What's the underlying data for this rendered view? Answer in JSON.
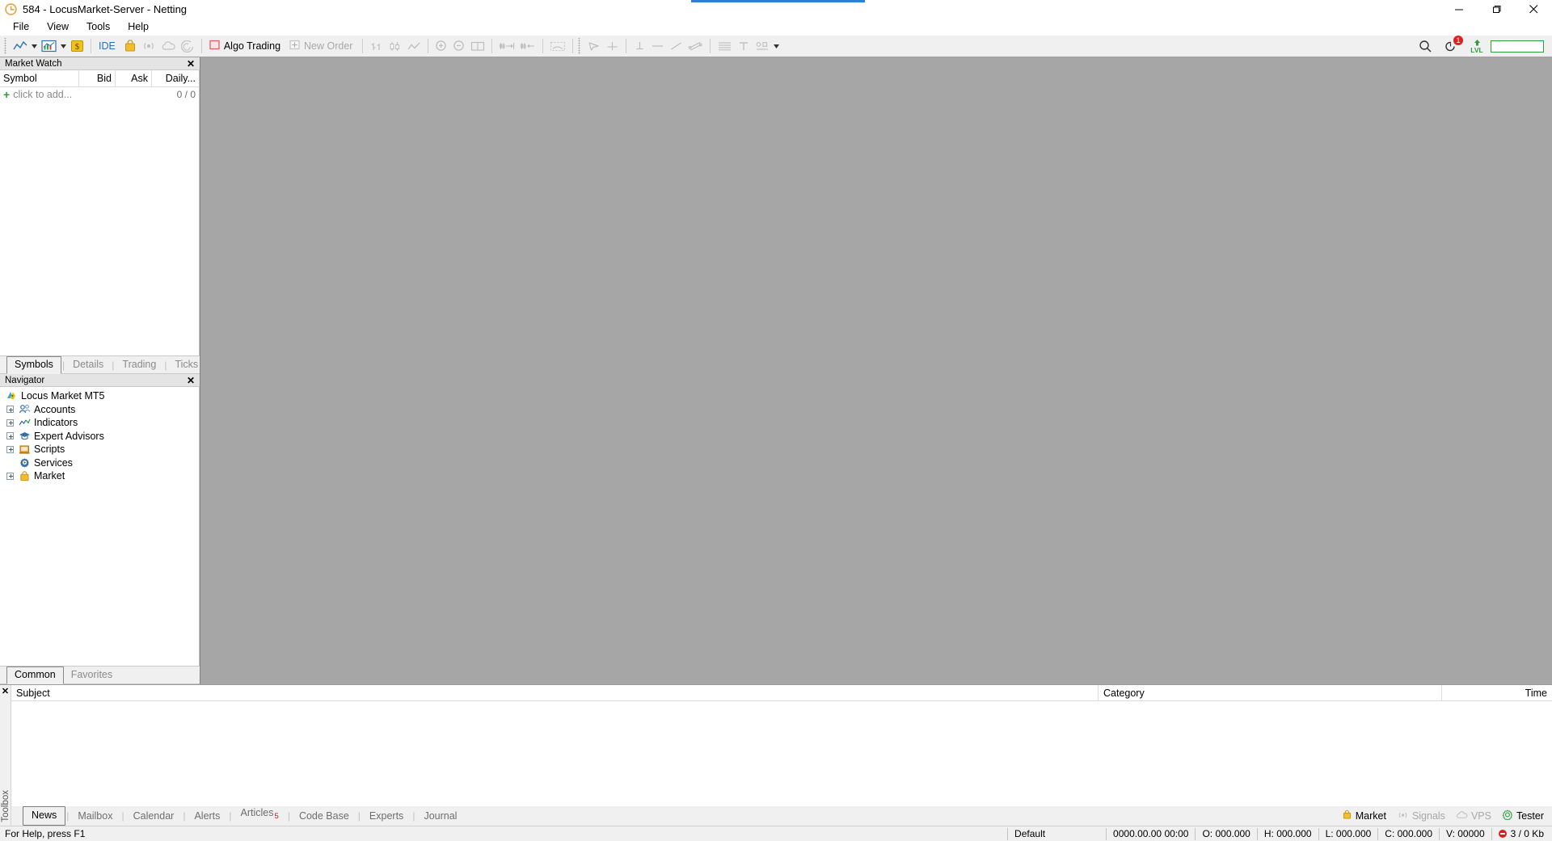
{
  "window": {
    "title": "584 - LocusMarket-Server - Netting",
    "logo_icon": "mt5-logo-icon",
    "minimize_icon": "minimize-icon",
    "maximize_icon": "maximize-icon",
    "close_icon": "close-icon"
  },
  "menu": {
    "items": [
      {
        "label": "File"
      },
      {
        "label": "View"
      },
      {
        "label": "Tools"
      },
      {
        "label": "Help"
      }
    ]
  },
  "toolbar": {
    "groups": [
      {
        "buttons": [
          {
            "name": "new-chart-button",
            "icon": "line-chart-icon",
            "enabled": true,
            "caret": true
          },
          {
            "name": "charts-window-button",
            "icon": "bar-chart-window-icon",
            "enabled": true,
            "caret": true
          },
          {
            "name": "currency-button",
            "icon": "dollar-coin-icon",
            "enabled": true,
            "caret": false
          }
        ]
      },
      {
        "buttons": [
          {
            "name": "metaeditor-button",
            "icon": "ide-icon",
            "label": "IDE",
            "enabled": true
          },
          {
            "name": "market-button",
            "icon": "market-bag-icon",
            "enabled": true
          },
          {
            "name": "signals-button",
            "icon": "signals-icon",
            "enabled": false
          },
          {
            "name": "vps-button",
            "icon": "vps-cloud-icon",
            "enabled": false
          },
          {
            "name": "tester-button",
            "icon": "tester-icon",
            "enabled": false
          }
        ]
      },
      {
        "buttons": [
          {
            "name": "algo-trading-button",
            "icon": "algo-trading-icon",
            "label": "Algo Trading",
            "enabled": true
          },
          {
            "name": "new-order-button",
            "icon": "new-order-icon",
            "label": "New Order",
            "enabled": false
          }
        ]
      },
      {
        "buttons": [
          {
            "name": "bar-chart-button",
            "icon": "bars-icon",
            "enabled": false
          },
          {
            "name": "candlestick-chart-button",
            "icon": "candles-icon",
            "enabled": false
          },
          {
            "name": "line-chart-button",
            "icon": "linechart-icon",
            "enabled": false
          }
        ]
      },
      {
        "buttons": [
          {
            "name": "zoom-in-button",
            "icon": "zoom-in-icon",
            "enabled": false
          },
          {
            "name": "zoom-out-button",
            "icon": "zoom-out-icon",
            "enabled": false
          },
          {
            "name": "chart-layout-button",
            "icon": "chart-layout-icon",
            "enabled": false
          }
        ]
      },
      {
        "buttons": [
          {
            "name": "auto-scroll-button",
            "icon": "auto-scroll-icon",
            "enabled": false
          },
          {
            "name": "chart-shift-button",
            "icon": "chart-shift-icon",
            "enabled": false
          }
        ]
      },
      {
        "buttons": [
          {
            "name": "indicators-button",
            "icon": "indicators-icon",
            "enabled": false
          }
        ]
      },
      {
        "buttons": [
          {
            "name": "cursor-button",
            "icon": "cursor-icon",
            "enabled": false
          },
          {
            "name": "crosshair-button",
            "icon": "crosshair-icon",
            "enabled": false
          }
        ]
      },
      {
        "buttons": [
          {
            "name": "vertical-line-button",
            "icon": "vertical-line-icon",
            "enabled": false
          },
          {
            "name": "horizontal-line-button",
            "icon": "horizontal-line-icon",
            "enabled": false
          },
          {
            "name": "trendline-button",
            "icon": "trendline-icon",
            "enabled": false
          },
          {
            "name": "equidistant-channel-button",
            "icon": "equidistant-channel-icon",
            "enabled": false
          }
        ]
      },
      {
        "buttons": [
          {
            "name": "fibonacci-button",
            "icon": "fibonacci-icon",
            "enabled": false
          },
          {
            "name": "text-button",
            "icon": "text-icon",
            "enabled": false
          },
          {
            "name": "objects-button",
            "icon": "objects-icon",
            "enabled": false,
            "caret": true
          }
        ]
      }
    ],
    "right": {
      "search_icon": "search-icon",
      "notifications_icon": "notifications-bell-icon",
      "notifications_count": "1",
      "lvl_icon": "lvl-up-icon",
      "lvl_label": "LVL",
      "search_input_value": "",
      "search_input_placeholder": "",
      "accent_color": "#2e9e3e"
    }
  },
  "market_watch": {
    "title": "Market Watch",
    "close_icon": "close-icon",
    "columns": [
      "Symbol",
      "Bid",
      "Ask",
      "Daily..."
    ],
    "add_row_label": "click to add...",
    "add_row_icon": "plus-icon",
    "count": "0 / 0",
    "tabs": [
      {
        "label": "Symbols",
        "active": true
      },
      {
        "label": "Details",
        "active": false
      },
      {
        "label": "Trading",
        "active": false
      },
      {
        "label": "Ticks",
        "active": false
      }
    ]
  },
  "navigator": {
    "title": "Navigator",
    "close_icon": "close-icon",
    "root": {
      "label": "Locus Market MT5",
      "icon": "mt5-logo-icon"
    },
    "items": [
      {
        "label": "Accounts",
        "icon": "accounts-icon",
        "expandable": true
      },
      {
        "label": "Indicators",
        "icon": "indicators-icon",
        "expandable": true
      },
      {
        "label": "Expert Advisors",
        "icon": "expert-advisors-icon",
        "expandable": true
      },
      {
        "label": "Scripts",
        "icon": "scripts-icon",
        "expandable": true
      },
      {
        "label": "Services",
        "icon": "services-icon",
        "expandable": false
      },
      {
        "label": "Market",
        "icon": "market-bag-icon",
        "expandable": true
      }
    ],
    "tabs": [
      {
        "label": "Common",
        "active": true
      },
      {
        "label": "Favorites",
        "active": false
      }
    ]
  },
  "toolbox": {
    "close_icon": "close-icon",
    "rail_label": "Toolbox",
    "columns": [
      "Subject",
      "Category",
      "Time"
    ],
    "tabs": [
      {
        "label": "News",
        "active": true,
        "badge": ""
      },
      {
        "label": "Mailbox",
        "active": false,
        "badge": ""
      },
      {
        "label": "Calendar",
        "active": false,
        "badge": ""
      },
      {
        "label": "Alerts",
        "active": false,
        "badge": ""
      },
      {
        "label": "Articles",
        "active": false,
        "badge": "5"
      },
      {
        "label": "Code Base",
        "active": false,
        "badge": ""
      },
      {
        "label": "Experts",
        "active": false,
        "badge": ""
      },
      {
        "label": "Journal",
        "active": false,
        "badge": ""
      }
    ],
    "status_items": [
      {
        "label": "Market",
        "icon": "market-bag-icon",
        "enabled": true
      },
      {
        "label": "Signals",
        "icon": "signals-icon",
        "enabled": false
      },
      {
        "label": "VPS",
        "icon": "vps-cloud-icon",
        "enabled": false
      },
      {
        "label": "Tester",
        "icon": "tester-icon",
        "enabled": true
      }
    ]
  },
  "statusbar": {
    "help_text": "For Help, press F1",
    "profile": "Default",
    "datetime": "0000.00.00 00:00",
    "open": "O: 000.000",
    "high": "H: 000.000",
    "low": "L: 000.000",
    "close": "C: 000.000",
    "volume": "V: 00000",
    "connection_icon": "disconnected-icon",
    "traffic": "3 / 0 Kb"
  }
}
